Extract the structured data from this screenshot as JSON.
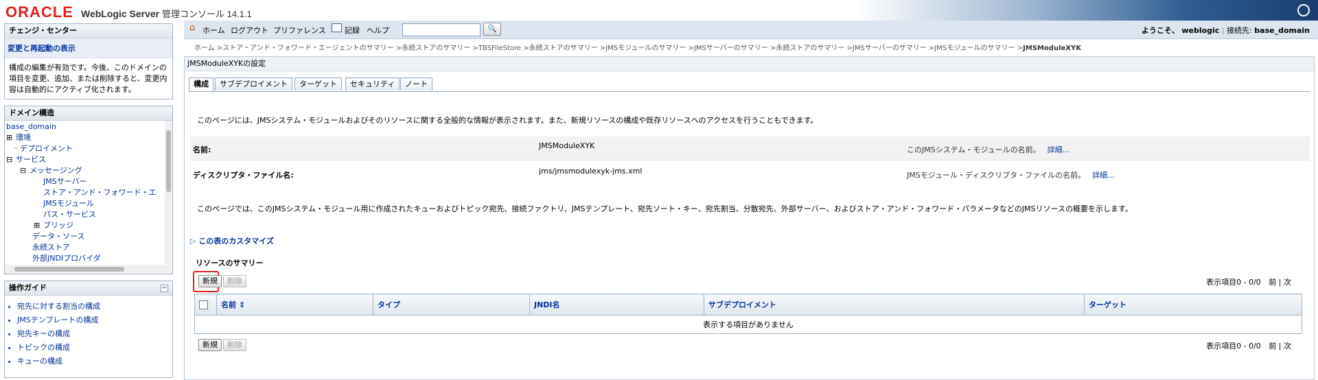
{
  "header": {
    "logo": "ORACLE",
    "product": "WebLogic Server",
    "product_sub": "管理コンソール 14.1.1"
  },
  "change_center": {
    "title": "チェンジ・センター",
    "link": "変更と再起動の表示",
    "message": "構成の編集が有効です。今後、このドメインの項目を変更、追加、または削除すると、変更内容は自動的にアクティブ化されます。"
  },
  "domain_tree": {
    "title": "ドメイン構造",
    "nodes": [
      "base_domain",
      "環境",
      "デプロイメント",
      "サービス",
      "メッセージング",
      "JMSサーバー",
      "ストア・アンド・フォワード・エ",
      "JMSモジュール",
      "パス・サービス",
      "ブリッジ",
      "データ・ソース",
      "永続ストア",
      "外部JNDIプロバイダ"
    ]
  },
  "guide": {
    "title": "操作ガイド",
    "items": [
      "宛先に対する割当の構成",
      "JMSテンプレートの構成",
      "宛先キーの構成",
      "トピックの構成",
      "キューの構成"
    ]
  },
  "menubar": {
    "home": "ホーム",
    "logout": "ログアウト",
    "preferences": "プリファレンス",
    "record": "記録",
    "help": "ヘルプ",
    "search_value": "",
    "welcome": "ようこそ、",
    "user": "weblogic",
    "connected": "接続先:",
    "domain": "base_domain"
  },
  "breadcrumb": {
    "path": "ホーム >ストア・アンド・フォワード・エージェントのサマリー >永続ストアのサマリー >TBSFileStore >永続ストアのサマリー >JMSモジュールのサマリー >JMSサーバーのサマリー >永続ストアのサマリー >JMSサーバーのサマリー >JMSモジュールのサマリー >",
    "current": "JMSModuleXYK"
  },
  "page": {
    "title": "JMSModuleXYKの設定",
    "tabs": [
      "構成",
      "サブデプロイメント",
      "ターゲット",
      "セキュリティ",
      "ノート"
    ],
    "intro": "このページには、JMSシステム・モジュールおよびそのリソースに関する全般的な情報が表示されます。また、新規リソースの構成や既存リソースへのアクセスを行うこともできます。",
    "name_label": "名前:",
    "name_value": "JMSModuleXYK",
    "name_hint": "このJMSシステム・モジュールの名前。",
    "descriptor_label": "ディスクリプタ・ファイル名:",
    "descriptor_value": "jms/jmsmodulexyk-jms.xml",
    "descriptor_hint": "JMSモジュール・ディスクリプタ・ファイルの名前。",
    "more": "詳細...",
    "summary_text": "このページでは、このJMSシステム・モジュール用に作成されたキューおよびトピック宛先、接続ファクトリ、JMSテンプレート、宛先ソート・キー、宛先割当、分散宛先、外部サーバー、およびストア・アンド・フォワード・パラメータなどのJMSリソースの概要を示します。",
    "customize": "この表のカスタマイズ",
    "resources_title": "リソースのサマリー",
    "new_button": "新規",
    "delete_button": "削除",
    "pager": "表示項目0 - 0/0",
    "prev": "前",
    "next": "次",
    "columns": [
      "名前",
      "タイプ",
      "JNDI名",
      "サブデプロイメント",
      "ターゲット"
    ],
    "empty": "表示する項目がありません"
  }
}
